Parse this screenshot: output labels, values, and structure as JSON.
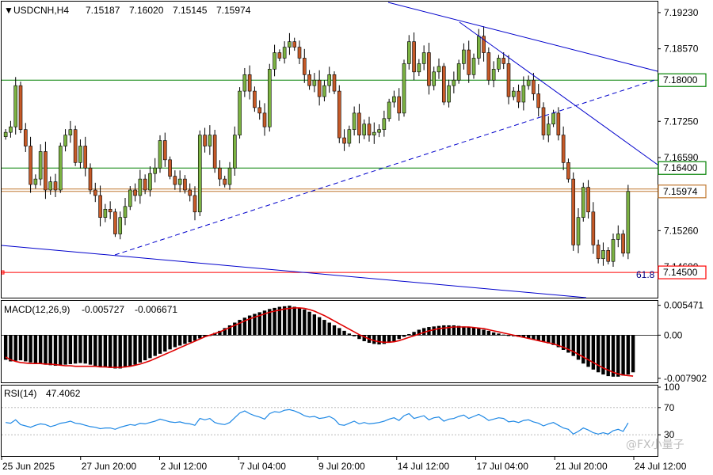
{
  "header": {
    "symbol": "USDCNH,H4",
    "open": "7.15187",
    "high": "7.16020",
    "low": "7.15145",
    "close": "7.15974"
  },
  "macd": {
    "label": "MACD(12,26,9)",
    "main": "-0.005727",
    "signal": "-0.006671"
  },
  "rsi": {
    "label": "RSI(14)",
    "value": "47.4062"
  },
  "watermark": "@FX小量子",
  "fib_label": "61.8",
  "price_levels": [
    {
      "value": 7.18,
      "label": "7.18000",
      "color": "#008000"
    },
    {
      "value": 7.164,
      "label": "7.16400",
      "color": "#008000"
    },
    {
      "value": 7.15974,
      "label": "7.15974",
      "color": "#c07830"
    },
    {
      "value": 7.145,
      "label": "7.14500",
      "color": "#ff0000"
    }
  ],
  "colors": {
    "bull": "#7cb342",
    "bear": "#c65a28",
    "macd_signal": "#e00000",
    "rsi_line": "#1e88e5",
    "trend": "#0000cc"
  },
  "chart_data": [
    {
      "type": "candlestick",
      "title": "USDCNH,H4",
      "ylim": [
        7.1404,
        7.1943
      ],
      "y_ticks": [
        "7.19230",
        "7.18570",
        "7.17250",
        "7.16590",
        "7.15260",
        "7.14600"
      ],
      "x_ticks": [
        "25 Jun 2025",
        "27 Jun 20:00",
        "2 Jul 12:00",
        "7 Jul 04:00",
        "9 Jul 20:00",
        "14 Jul 12:00",
        "17 Jul 04:00",
        "21 Jul 20:00",
        "24 Jul 12:00"
      ],
      "close": [
        7.1705,
        7.1715,
        7.179,
        7.171,
        7.168,
        7.161,
        7.162,
        7.167,
        7.16,
        7.1615,
        7.16,
        7.168,
        7.17,
        7.171,
        7.165,
        7.168,
        7.164,
        7.16,
        7.159,
        7.155,
        7.1565,
        7.156,
        7.152,
        7.155,
        7.157,
        7.16,
        7.159,
        7.162,
        7.16,
        7.163,
        7.164,
        7.169,
        7.1655,
        7.1625,
        7.161,
        7.162,
        7.16,
        7.159,
        7.156,
        7.17,
        7.168,
        7.17,
        7.164,
        7.162,
        7.161,
        7.164,
        7.17,
        7.178,
        7.181,
        7.178,
        7.175,
        7.174,
        7.1715,
        7.182,
        7.185,
        7.184,
        7.186,
        7.187,
        7.186,
        7.184,
        7.181,
        7.179,
        7.18,
        7.177,
        7.179,
        7.181,
        7.178,
        7.1695,
        7.1685,
        7.171,
        7.174,
        7.17,
        7.172,
        7.17,
        7.1705,
        7.171,
        7.173,
        7.176,
        7.177,
        7.174,
        7.183,
        7.187,
        7.1815,
        7.183,
        7.185,
        7.179,
        7.1815,
        7.1825,
        7.176,
        7.179,
        7.18,
        7.183,
        7.1855,
        7.181,
        7.184,
        7.188,
        7.185,
        7.18,
        7.182,
        7.184,
        7.183,
        7.177,
        7.178,
        7.176,
        7.179,
        7.18,
        7.1775,
        7.175,
        7.17,
        7.172,
        7.174,
        7.17,
        7.165,
        7.162,
        7.15,
        7.155,
        7.1605,
        7.156,
        7.15,
        7.1475,
        7.149,
        7.147,
        7.151,
        7.152,
        7.1485,
        7.15974
      ],
      "annotations": [
        "61.8"
      ]
    },
    {
      "type": "bar",
      "title": "MACD(12,26,9)",
      "ylim": [
        -0.0085,
        0.006
      ],
      "y_ticks": [
        "0.005471",
        "0.00",
        "-0.007902"
      ],
      "histogram": [
        -0.0045,
        -0.0048,
        -0.0047,
        -0.0046,
        -0.0048,
        -0.005,
        -0.0052,
        -0.0053,
        -0.0054,
        -0.0055,
        -0.0056,
        -0.0055,
        -0.0054,
        -0.0053,
        -0.0052,
        -0.0051,
        -0.0052,
        -0.0054,
        -0.0056,
        -0.0058,
        -0.0059,
        -0.006,
        -0.0061,
        -0.0061,
        -0.0059,
        -0.0057,
        -0.0054,
        -0.005,
        -0.0046,
        -0.0042,
        -0.0038,
        -0.0034,
        -0.003,
        -0.0026,
        -0.0022,
        -0.0019,
        -0.0016,
        -0.0013,
        -0.001,
        -0.0006,
        -0.0003,
        0.0,
        0.0004,
        0.0008,
        0.0013,
        0.0018,
        0.0023,
        0.0028,
        0.0032,
        0.0036,
        0.0039,
        0.0042,
        0.0045,
        0.0048,
        0.005,
        0.0052,
        0.0053,
        0.0054,
        0.0052,
        0.005,
        0.0047,
        0.0043,
        0.0038,
        0.0033,
        0.0028,
        0.0023,
        0.0018,
        0.0013,
        0.0008,
        0.0003,
        -0.0002,
        -0.0007,
        -0.0011,
        -0.0014,
        -0.0016,
        -0.0017,
        -0.0016,
        -0.0014,
        -0.0011,
        -0.0007,
        -0.0003,
        0.0002,
        0.0006,
        0.001,
        0.0013,
        0.0015,
        0.0016,
        0.0017,
        0.0018,
        0.0018,
        0.0018,
        0.0017,
        0.0016,
        0.0015,
        0.0014,
        0.0012,
        0.001,
        0.0008,
        0.0005,
        0.0003,
        0.0001,
        -0.0001,
        -0.0002,
        -0.0003,
        -0.0004,
        -0.0006,
        -0.0008,
        -0.001,
        -0.0012,
        -0.0015,
        -0.0018,
        -0.0022,
        -0.0027,
        -0.0032,
        -0.0038,
        -0.0045,
        -0.0052,
        -0.0058,
        -0.0063,
        -0.0068,
        -0.0072,
        -0.0075,
        -0.0076,
        -0.0076,
        -0.0074,
        -0.0072,
        -0.0068
      ],
      "signal": [
        -0.004,
        -0.0045,
        -0.0048,
        -0.005,
        -0.0051,
        -0.0052,
        -0.0052,
        -0.0052,
        -0.0053,
        -0.0053,
        -0.0054,
        -0.0055,
        -0.0056,
        -0.0056,
        -0.0057,
        -0.0057,
        -0.0057,
        -0.0057,
        -0.0057,
        -0.0058,
        -0.0058,
        -0.0059,
        -0.0059,
        -0.0059,
        -0.0058,
        -0.0057,
        -0.0055,
        -0.0053,
        -0.005,
        -0.0047,
        -0.0043,
        -0.0039,
        -0.0035,
        -0.0031,
        -0.0027,
        -0.0023,
        -0.0019,
        -0.0015,
        -0.0011,
        -0.0007,
        -0.0003,
        0.0,
        0.0003,
        0.0006,
        0.001,
        0.0014,
        0.0018,
        0.0022,
        0.0026,
        0.003,
        0.0033,
        0.0036,
        0.0039,
        0.0042,
        0.0044,
        0.0046,
        0.0048,
        0.0049,
        0.005,
        0.005,
        0.0049,
        0.0047,
        0.0044,
        0.004,
        0.0036,
        0.0031,
        0.0026,
        0.0021,
        0.0016,
        0.0011,
        0.0006,
        0.0001,
        -0.0003,
        -0.0007,
        -0.001,
        -0.0012,
        -0.0013,
        -0.0013,
        -0.0012,
        -0.001,
        -0.0007,
        -0.0004,
        -0.0001,
        0.0002,
        0.0005,
        0.0008,
        0.001,
        0.0012,
        0.0013,
        0.0014,
        0.0015,
        0.0015,
        0.0015,
        0.0015,
        0.0014,
        0.0013,
        0.0012,
        0.001,
        0.0008,
        0.0006,
        0.0004,
        0.0002,
        0.0,
        -0.0002,
        -0.0004,
        -0.0006,
        -0.0008,
        -0.001,
        -0.0012,
        -0.0014,
        -0.0016,
        -0.0019,
        -0.0022,
        -0.0026,
        -0.003,
        -0.0035,
        -0.004,
        -0.0045,
        -0.005,
        -0.0055,
        -0.006,
        -0.0064,
        -0.0068,
        -0.0071,
        -0.0073,
        -0.0074,
        -0.0075
      ]
    },
    {
      "type": "line",
      "title": "RSI(14)",
      "ylim": [
        0,
        100
      ],
      "y_ticks": [
        "100",
        "70",
        "30",
        "0"
      ],
      "levels": [
        70,
        30
      ],
      "values": [
        48,
        47,
        52,
        45,
        43,
        41,
        44,
        46,
        45,
        42,
        44,
        47,
        48,
        50,
        47,
        46,
        44,
        42,
        41,
        39,
        40,
        40,
        38,
        41,
        43,
        45,
        44,
        47,
        46,
        48,
        50,
        53,
        51,
        49,
        48,
        49,
        47,
        46,
        44,
        54,
        52,
        54,
        48,
        46,
        45,
        48,
        55,
        62,
        65,
        61,
        58,
        56,
        53,
        61,
        64,
        63,
        66,
        67,
        65,
        62,
        58,
        56,
        57,
        54,
        55,
        57,
        53,
        45,
        44,
        47,
        50,
        46,
        48,
        46,
        47,
        48,
        50,
        53,
        55,
        51,
        58,
        61,
        54,
        56,
        58,
        52,
        55,
        56,
        50,
        53,
        54,
        57,
        59,
        54,
        57,
        60,
        56,
        51,
        53,
        55,
        54,
        49,
        50,
        48,
        51,
        52,
        49,
        47,
        43,
        46,
        48,
        44,
        40,
        38,
        31,
        35,
        40,
        37,
        33,
        31,
        33,
        31,
        36,
        38,
        35,
        47.4
      ]
    }
  ]
}
